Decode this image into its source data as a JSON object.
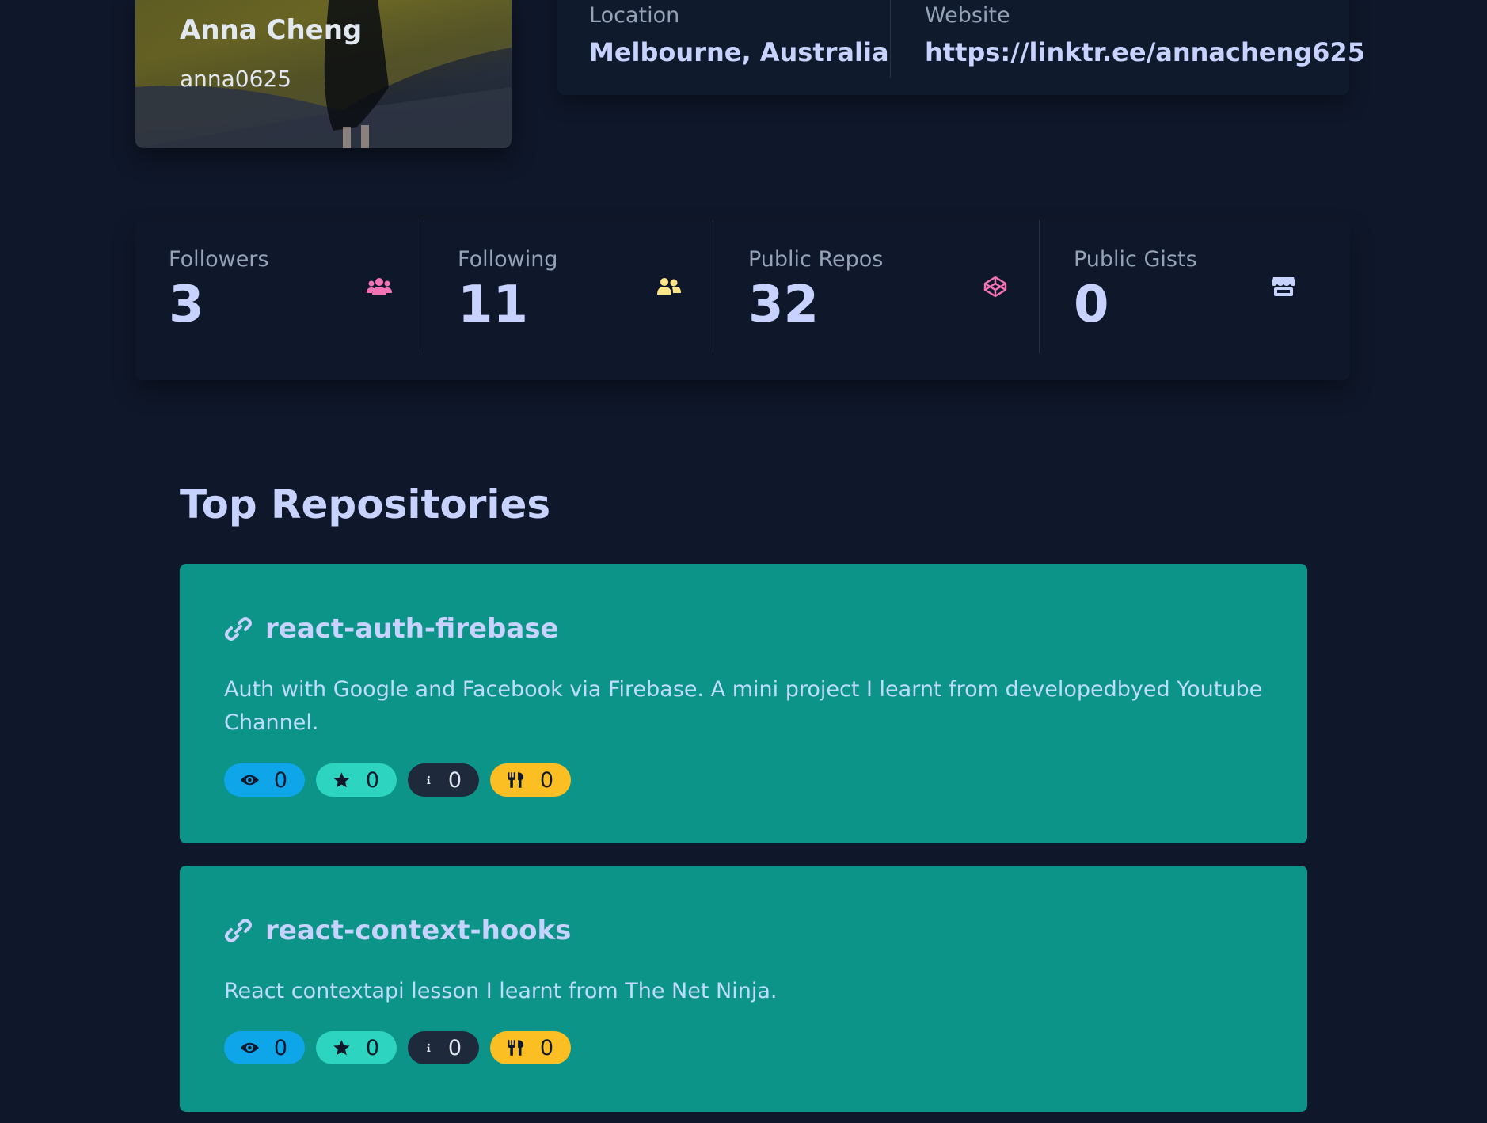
{
  "profile": {
    "name": "Anna Cheng",
    "login": "anna0625"
  },
  "info": {
    "location_label": "Location",
    "location_value": "Melbourne, Australia",
    "website_label": "Website",
    "website_value": "https://linktr.ee/annacheng625"
  },
  "stats": [
    {
      "label": "Followers",
      "value": "3",
      "icon": "users-icon",
      "color": "#f472b6"
    },
    {
      "label": "Following",
      "value": "11",
      "icon": "user-friends-icon",
      "color": "#fde68a"
    },
    {
      "label": "Public Repos",
      "value": "32",
      "icon": "codepen-icon",
      "color": "#f472b6"
    },
    {
      "label": "Public Gists",
      "value": "0",
      "icon": "store-icon",
      "color": "#c7d2fe"
    }
  ],
  "repositories": {
    "title": "Top Repositories",
    "items": [
      {
        "name": "react-auth-firebase",
        "description": "Auth with Google and Facebook via Firebase. A mini project I learnt from developedbyed Youtube Channel.",
        "watchers": "0",
        "stars": "0",
        "issues": "0",
        "forks": "0"
      },
      {
        "name": "react-context-hooks",
        "description": "React contextapi lesson I learnt from The Net Ninja.",
        "watchers": "0",
        "stars": "0",
        "issues": "0",
        "forks": "0"
      }
    ]
  },
  "colors": {
    "background": "#0f172a",
    "repo_card": "#0d9488",
    "watchers_badge": "#0ea5e9",
    "stars_badge": "#2dd4bf",
    "issues_badge": "#1e293b",
    "forks_badge": "#fbbf24"
  }
}
